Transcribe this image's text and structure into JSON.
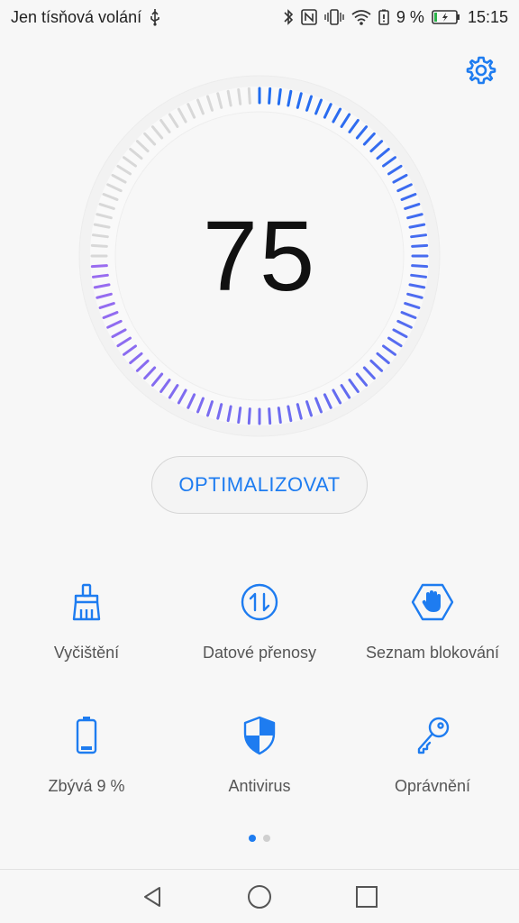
{
  "status_bar": {
    "carrier": "Jen tísňová volání",
    "battery_percent_text": "9 %",
    "time": "15:15",
    "icons": [
      "usb-icon",
      "bluetooth-icon",
      "nfc-icon",
      "vibrate-icon",
      "wifi-icon",
      "battery-saver-icon",
      "battery-charging-icon"
    ]
  },
  "settings": {
    "icon": "gear-icon"
  },
  "score": {
    "value": "75",
    "fraction": 0.75,
    "colors": {
      "start": "#1e6cf0",
      "end": "#9a6cf0",
      "inactive": "#d8d8d8"
    }
  },
  "optimize_button": {
    "label": "OPTIMALIZOVAT"
  },
  "tools": [
    {
      "label": "Vyčištění",
      "icon": "broom-icon"
    },
    {
      "label": "Datové přenosy",
      "icon": "data-transfer-icon"
    },
    {
      "label": "Seznam blokování",
      "icon": "block-hand-icon"
    },
    {
      "label": "Zbývá 9 %",
      "icon": "battery-icon"
    },
    {
      "label": "Antivirus",
      "icon": "shield-icon"
    },
    {
      "label": "Oprávnění",
      "icon": "key-icon"
    }
  ],
  "pager": {
    "pages": 2,
    "active": 0
  },
  "navigation": {
    "icons": [
      "back-icon",
      "home-icon",
      "recents-icon"
    ]
  },
  "accent_color": "#1e7cf0"
}
